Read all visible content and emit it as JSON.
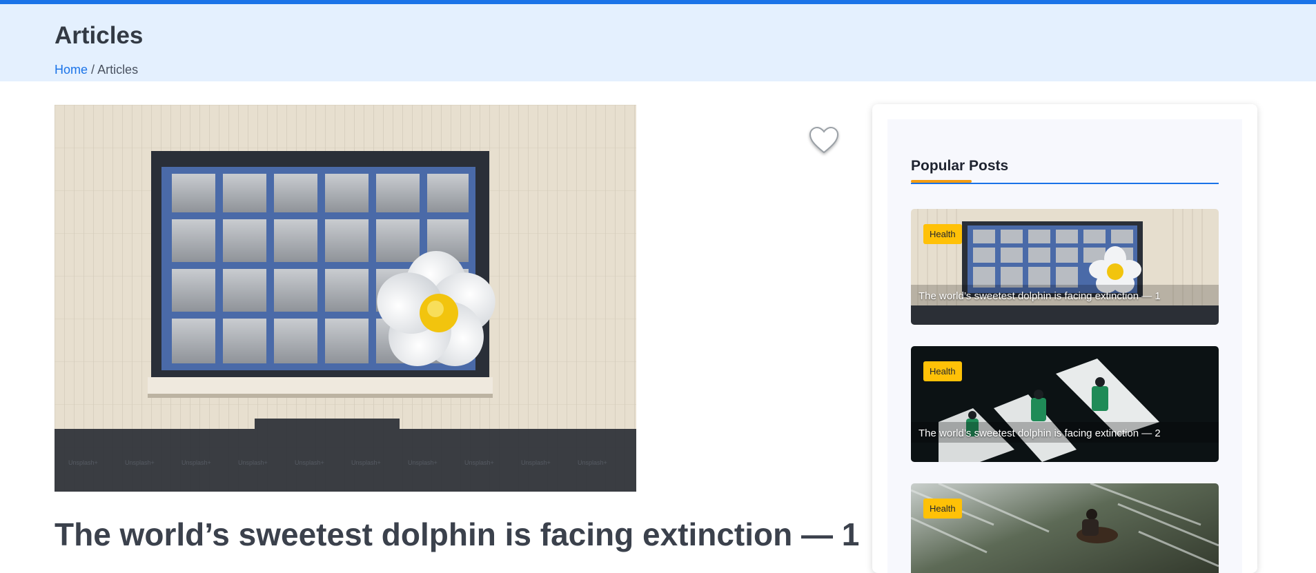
{
  "header": {
    "title": "Articles",
    "breadcrumb": {
      "home": "Home",
      "separator": "/",
      "current": "Articles"
    }
  },
  "article": {
    "title": "The world’s sweetest dolphin is facing extinction — 1",
    "like_icon": "heart-icon",
    "hero_watermark": "Unsplash+"
  },
  "sidebar": {
    "title": "Popular Posts",
    "posts": [
      {
        "category": "Health",
        "title": "The world’s sweetest dolphin is facing extinction — 1"
      },
      {
        "category": "Health",
        "title": "The world’s sweetest dolphin is facing extinction — 2"
      },
      {
        "category": "Health",
        "title": ""
      }
    ]
  },
  "colors": {
    "accent": "#1a73e8",
    "header_bg": "#e4f0fe",
    "badge": "#ffc107",
    "title_accent": "#f39c12"
  }
}
